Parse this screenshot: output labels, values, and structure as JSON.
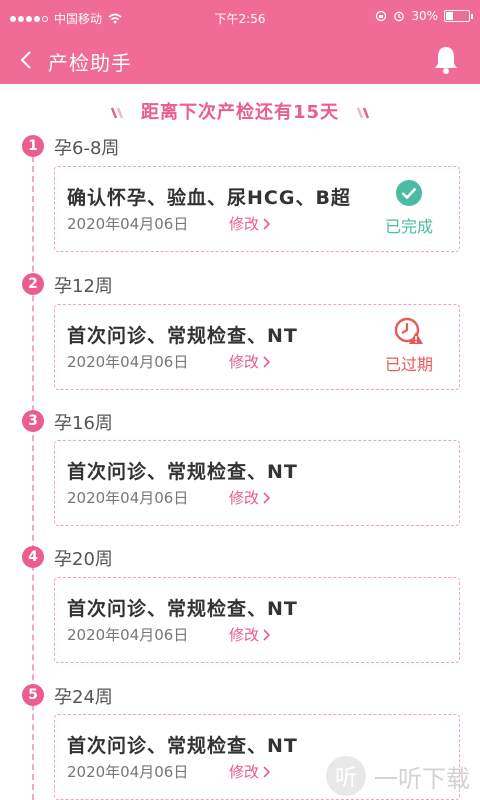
{
  "status_bar": {
    "carrier": "中国移动",
    "time": "下午2:56",
    "battery": "30%",
    "battery_level": 0.3
  },
  "nav": {
    "title": "产检助手",
    "back_icon": "chevron-left-icon",
    "bell_icon": "bell-icon"
  },
  "countdown_text": "距离下次产检还有15天",
  "colors": {
    "brand": "#f06b95",
    "accent": "#ea5d8c",
    "done": "#4bbba1",
    "expired": "#e85a5a"
  },
  "stages": [
    {
      "num": "1",
      "week": "孕6-8周",
      "title": "确认怀孕、验血、尿HCG、B超",
      "date": "2020年04月06日",
      "edit": "修改",
      "status": "已完成",
      "status_type": "done"
    },
    {
      "num": "2",
      "week": "孕12周",
      "title": "首次问诊、常规检查、NT",
      "date": "2020年04月06日",
      "edit": "修改",
      "status": "已过期",
      "status_type": "expired"
    },
    {
      "num": "3",
      "week": "孕16周",
      "title": "首次问诊、常规检查、NT",
      "date": "2020年04月06日",
      "edit": "修改"
    },
    {
      "num": "4",
      "week": "孕20周",
      "title": "首次问诊、常规检查、NT",
      "date": "2020年04月06日",
      "edit": "修改"
    },
    {
      "num": "5",
      "week": "孕24周",
      "title": "首次问诊、常规检查、NT",
      "date": "2020年04月06日",
      "edit": "修改"
    }
  ],
  "watermark": {
    "logo_char": "听",
    "text": "一听下载"
  }
}
